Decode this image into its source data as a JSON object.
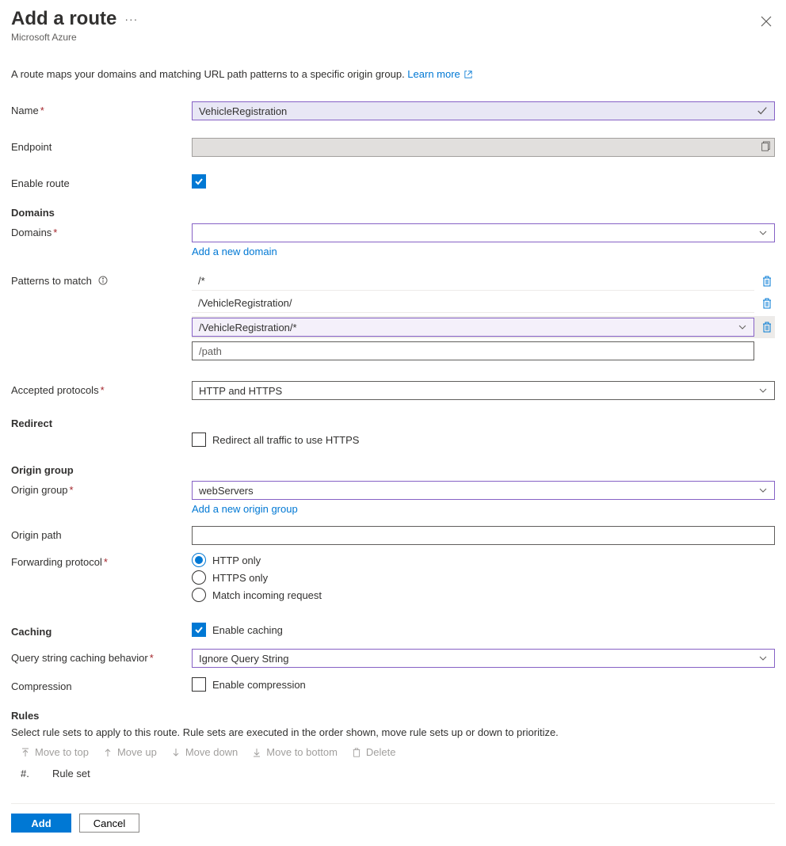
{
  "header": {
    "title": "Add a route",
    "subtitle": "Microsoft Azure"
  },
  "description": {
    "text": "A route maps your domains and matching URL path patterns to a specific origin group. ",
    "learn_more": "Learn more"
  },
  "labels": {
    "name": "Name",
    "endpoint": "Endpoint",
    "enable_route": "Enable route",
    "domains_heading": "Domains",
    "domains": "Domains",
    "patterns_to_match": "Patterns to match",
    "accepted_protocols": "Accepted protocols",
    "redirect_heading": "Redirect",
    "redirect_label": "Redirect all traffic to use HTTPS",
    "origin_group_heading": "Origin group",
    "origin_group": "Origin group",
    "origin_path": "Origin path",
    "forwarding_protocol": "Forwarding protocol",
    "caching_heading": "Caching",
    "enable_caching": "Enable caching",
    "query_caching": "Query string caching behavior",
    "compression": "Compression",
    "enable_compression": "Enable compression",
    "rules_heading": "Rules",
    "rules_sub": "Select rule sets to apply to this route. Rule sets are executed in the order shown, move rule sets up or down to prioritize.",
    "col_num": "#.",
    "col_ruleset": "Rule set"
  },
  "links": {
    "add_domain": "Add a new domain",
    "add_origin_group": "Add a new origin group"
  },
  "values": {
    "name": "VehicleRegistration",
    "endpoint": "",
    "enable_route": true,
    "domains": "",
    "patterns": [
      "/*",
      "/VehicleRegistration/",
      "/VehicleRegistration/*"
    ],
    "path_placeholder": "/path",
    "accepted_protocols": "HTTP and HTTPS",
    "redirect_https": false,
    "origin_group": "webServers",
    "origin_path": "",
    "forwarding_protocol_options": [
      "HTTP only",
      "HTTPS only",
      "Match incoming request"
    ],
    "forwarding_protocol_selected": "HTTP only",
    "enable_caching": true,
    "query_caching": "Ignore Query String",
    "enable_compression": false
  },
  "toolbar": {
    "move_top": "Move to top",
    "move_up": "Move up",
    "move_down": "Move down",
    "move_bottom": "Move to bottom",
    "delete": "Delete"
  },
  "buttons": {
    "add": "Add",
    "cancel": "Cancel"
  }
}
